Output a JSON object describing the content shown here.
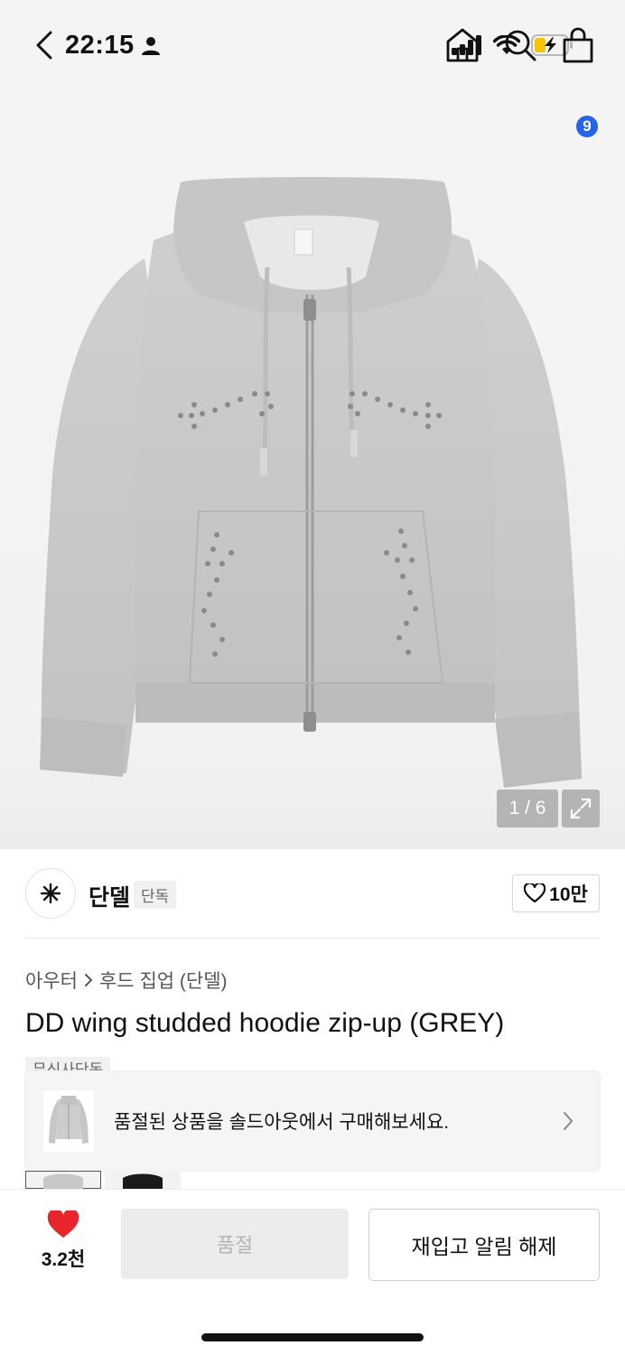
{
  "status_bar": {
    "time": "22:15",
    "icons": [
      "person-icon",
      "signal-icon",
      "wifi-icon",
      "battery-charging-icon"
    ]
  },
  "nav": {
    "icons": [
      "back-icon",
      "home-icon",
      "search-icon",
      "cart-icon"
    ],
    "cart_count": "9"
  },
  "gallery": {
    "counter": "1 / 6",
    "current": 1,
    "total": 6
  },
  "brand": {
    "name": "단델",
    "tag": "단독",
    "like_count": "10만"
  },
  "product": {
    "breadcrumb": [
      "아우터",
      "후드 집업 (단델)"
    ],
    "title": "DD wing studded hoodie zip-up (GREY)",
    "exclusive_tag": "무신사단독"
  },
  "soldout_banner": {
    "text": "품절된 상품을 솔드아웃에서 구매해보세요."
  },
  "bottom": {
    "heart_count": "3.2천",
    "soldout_label": "품절",
    "restock_label": "재입고 알림 해제"
  },
  "colors": {
    "accent_blue": "#2563eb",
    "heart_red": "#e8252d",
    "hoodie_grey": "#c8c8c8"
  }
}
